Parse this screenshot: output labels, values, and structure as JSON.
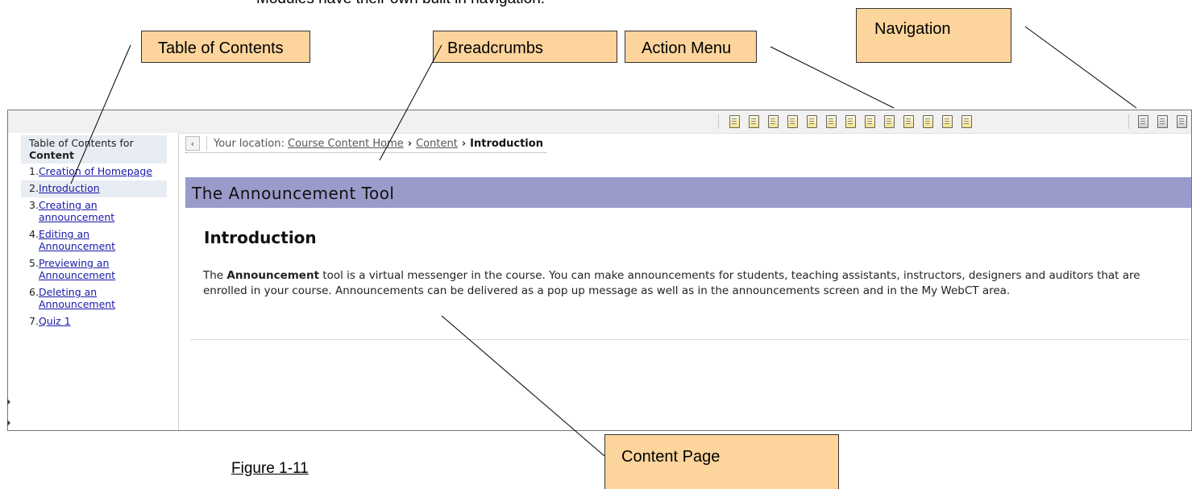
{
  "caption_top": "Modules have their own built in navigation.",
  "figure_caption": "Figure 1-11",
  "callouts": {
    "toc": "Table of Contents",
    "breadcrumbs": "Breadcrumbs",
    "action_menu": "Action Menu",
    "navigation": "Navigation",
    "content_page": "Content Page"
  },
  "toolbar": {
    "actions": [
      "pin-icon",
      "notes-icon",
      "search-icon",
      "document-icon",
      "copy-icon",
      "comment-icon",
      "web-icon",
      "edit-icon",
      "pin-icon",
      "find-icon",
      "print-icon",
      "bookmark-icon",
      "export-icon"
    ],
    "navigation": [
      "previous-icon",
      "back-icon",
      "next-icon"
    ]
  },
  "toc": {
    "heading_prefix": "Table of Contents for",
    "heading_bold": "Content",
    "items": [
      {
        "num": "1.",
        "label": "Creation of Homepage"
      },
      {
        "num": "2.",
        "label": "Introduction"
      },
      {
        "num": "3.",
        "label": "Creating an announcement"
      },
      {
        "num": "4.",
        "label": "Editing an Announcement"
      },
      {
        "num": "5.",
        "label": "Previewing an Announcement"
      },
      {
        "num": "6.",
        "label": "Deleting an Announcement"
      },
      {
        "num": "7.",
        "label": "Quiz 1"
      }
    ]
  },
  "breadcrumb": {
    "back_glyph": "‹",
    "prefix": "Your location:",
    "links": [
      "Course Content Home",
      "Content"
    ],
    "separator": "›",
    "current": "Introduction"
  },
  "page": {
    "banner": "The Announcement Tool",
    "heading": "Introduction",
    "body_pre": "The ",
    "body_bold": "Announcement",
    "body_post": " tool is a virtual messenger in the course. You can make announcements for students, teaching assistants, instructors, designers and auditors that are enrolled in your course. Announcements can be delivered as a pop up message as well as in the announcements screen and in the My WebCT area."
  }
}
